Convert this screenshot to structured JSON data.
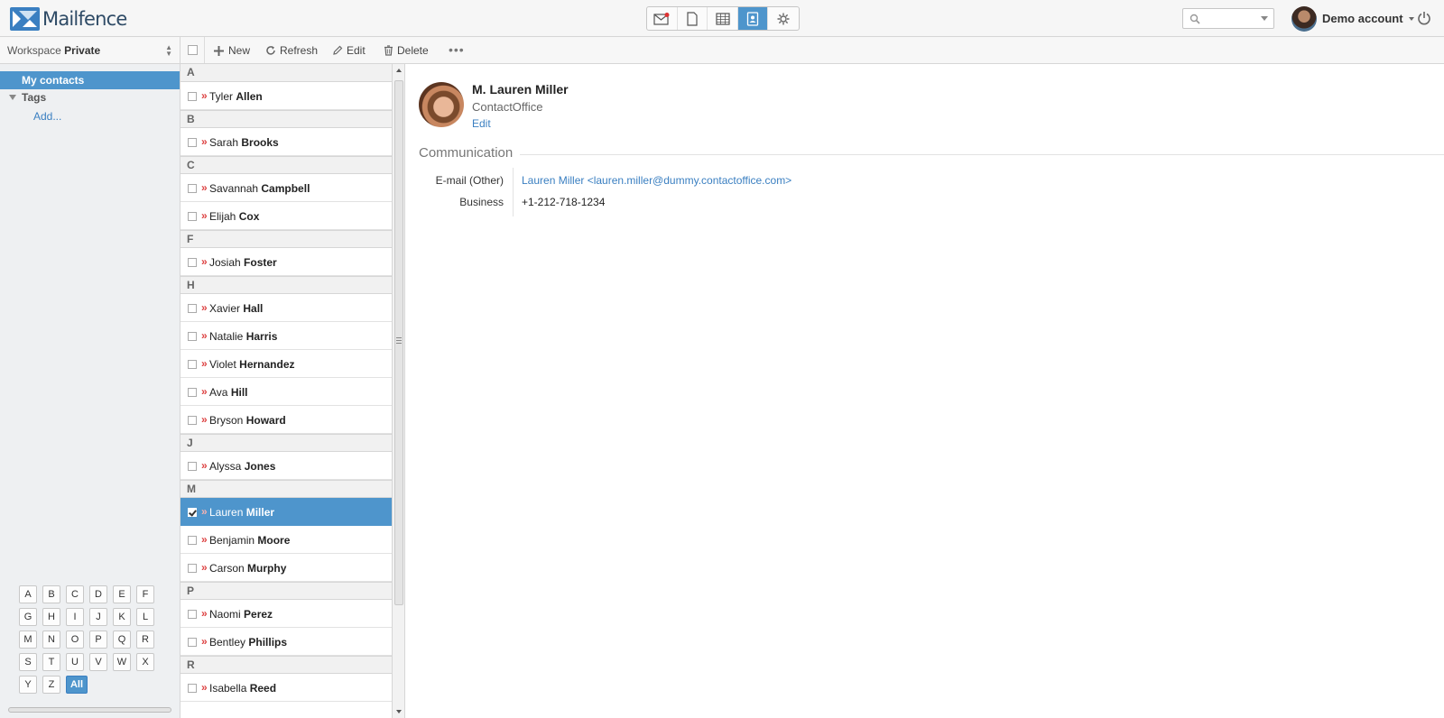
{
  "brand": {
    "name": "Mailfence"
  },
  "apps": [
    {
      "icon": "mail-icon",
      "active": false
    },
    {
      "icon": "document-icon",
      "active": false
    },
    {
      "icon": "calendar-icon",
      "active": false
    },
    {
      "icon": "contacts-icon",
      "active": true
    },
    {
      "icon": "settings-icon",
      "active": false
    }
  ],
  "search": {
    "placeholder": ""
  },
  "account": {
    "name": "Demo account"
  },
  "sidebar": {
    "workspace_label": "Workspace",
    "workspace_value": "Private",
    "my_contacts": "My contacts",
    "tags": "Tags",
    "add": "Add...",
    "letters": [
      "A",
      "B",
      "C",
      "D",
      "E",
      "F",
      "G",
      "H",
      "I",
      "J",
      "K",
      "L",
      "M",
      "N",
      "O",
      "P",
      "Q",
      "R",
      "S",
      "T",
      "U",
      "V",
      "W",
      "X",
      "Y",
      "Z"
    ],
    "all_label": "All"
  },
  "toolbar": {
    "new": "New",
    "refresh": "Refresh",
    "edit": "Edit",
    "delete": "Delete",
    "more": "•••"
  },
  "contacts": [
    {
      "letter": "A",
      "items": [
        {
          "first": "Tyler",
          "last": "Allen"
        }
      ]
    },
    {
      "letter": "B",
      "items": [
        {
          "first": "Sarah",
          "last": "Brooks"
        }
      ]
    },
    {
      "letter": "C",
      "items": [
        {
          "first": "Savannah",
          "last": "Campbell"
        },
        {
          "first": "Elijah",
          "last": "Cox"
        }
      ]
    },
    {
      "letter": "F",
      "items": [
        {
          "first": "Josiah",
          "last": "Foster"
        }
      ]
    },
    {
      "letter": "H",
      "items": [
        {
          "first": "Xavier",
          "last": "Hall"
        },
        {
          "first": "Natalie",
          "last": "Harris"
        },
        {
          "first": "Violet",
          "last": "Hernandez"
        },
        {
          "first": "Ava",
          "last": "Hill"
        },
        {
          "first": "Bryson",
          "last": "Howard"
        }
      ]
    },
    {
      "letter": "J",
      "items": [
        {
          "first": "Alyssa",
          "last": "Jones"
        }
      ]
    },
    {
      "letter": "M",
      "items": [
        {
          "first": "Lauren",
          "last": "Miller",
          "selected": true
        },
        {
          "first": "Benjamin",
          "last": "Moore"
        },
        {
          "first": "Carson",
          "last": "Murphy"
        }
      ]
    },
    {
      "letter": "P",
      "items": [
        {
          "first": "Naomi",
          "last": "Perez"
        },
        {
          "first": "Bentley",
          "last": "Phillips"
        }
      ]
    },
    {
      "letter": "R",
      "items": [
        {
          "first": "Isabella",
          "last": "Reed"
        }
      ]
    }
  ],
  "detail": {
    "name": "M. Lauren Miller",
    "company": "ContactOffice",
    "edit": "Edit",
    "section": "Communication",
    "email_label": "E-mail (Other)",
    "email_value": "Lauren Miller <lauren.miller@dummy.contactoffice.com>",
    "business_label": "Business",
    "business_value": "+1-212-718-1234"
  },
  "colors": {
    "accent": "#4e95cc",
    "link": "#3a7fc1",
    "chevron": "#dd4444"
  }
}
